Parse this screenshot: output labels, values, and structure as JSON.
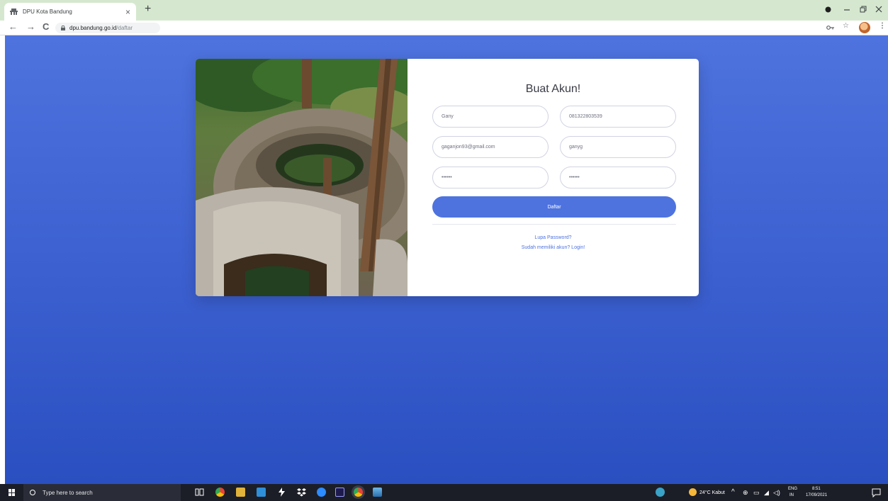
{
  "browser": {
    "tab_title": "DPU Kota Bandung",
    "tab_close": "×",
    "new_tab": "+",
    "url_host": "dpu.bandung.go.id",
    "url_path": "/daftar"
  },
  "form": {
    "title": "Buat Akun!",
    "fields": {
      "name": "Gany",
      "phone": "081322803539",
      "email": "gaganjon93@gmail.com",
      "username": "ganyg",
      "password": "••••••",
      "password_repeat": "••••••"
    },
    "submit_label": "Daftar",
    "forgot_link": "Lupa Password?",
    "login_link": "Sudah memiliki akun? Login!"
  },
  "taskbar": {
    "search_placeholder": "Type here to search",
    "weather": "24°C Kabut",
    "lang_top": "ENG",
    "lang_bottom": "IN",
    "time": "8:51",
    "date": "17/09/2021"
  },
  "colors": {
    "primary": "#4e73df",
    "page_bg_top": "#4e73de",
    "page_bg_bottom": "#2a4fc0",
    "tab_strip": "#d5e8cf"
  }
}
